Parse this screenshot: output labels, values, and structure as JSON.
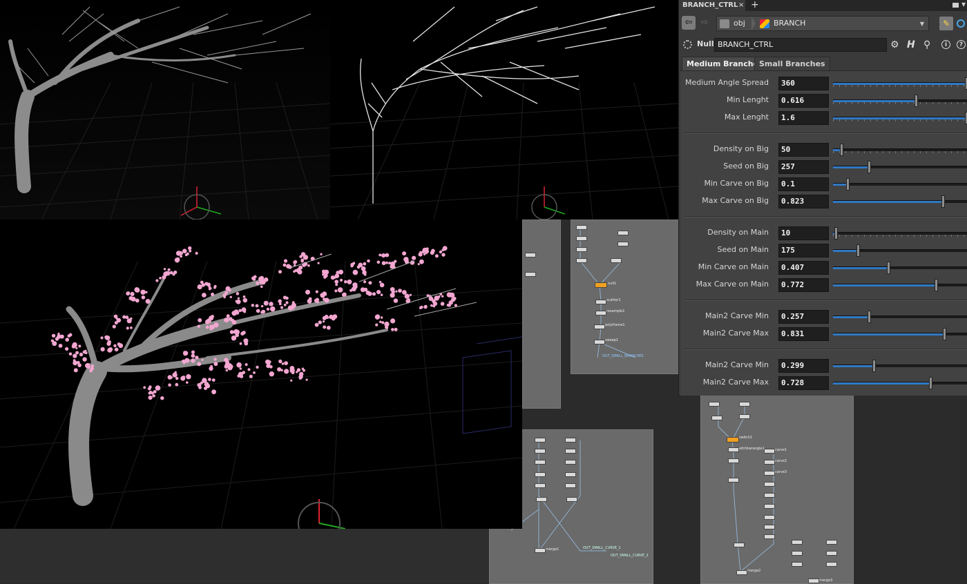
{
  "tab": {
    "title": "BRANCH_CTRL",
    "close": "×",
    "add": "+"
  },
  "path": {
    "back": "⇦",
    "forward": "⇨",
    "root": "obj",
    "node": "BRANCH",
    "dropdown": "▼"
  },
  "operator": {
    "type": "Null",
    "name": "BRANCH_CTRL",
    "help_letter": "H",
    "info_letter": "i",
    "question": "?"
  },
  "folders": [
    {
      "label": "Medium Branches",
      "active": true
    },
    {
      "label": "Small Branches",
      "active": false
    }
  ],
  "params": [
    {
      "label": "Medium Angle Spread",
      "value": "360",
      "slider": 1.0,
      "ticks": true
    },
    {
      "label": "Min Lenght",
      "value": "0.616",
      "slider": 0.62,
      "ticks": true
    },
    {
      "label": "Max Lenght",
      "value": "1.6",
      "slider": 1.0,
      "ticks": true
    },
    {
      "label": "Density on Big",
      "value": "50",
      "slider": 0.05,
      "ticks": true
    },
    {
      "label": "Seed on Big",
      "value": "257",
      "slider": 0.26,
      "ticks": false
    },
    {
      "label": "Min Carve on Big",
      "value": "0.1",
      "slider": 0.1,
      "ticks": false
    },
    {
      "label": "Max Carve on Big",
      "value": "0.823",
      "slider": 0.82,
      "ticks": false
    },
    {
      "label": "Density on Main",
      "value": "10",
      "slider": 0.01,
      "ticks": true
    },
    {
      "label": "Seed on Main",
      "value": "175",
      "slider": 0.18,
      "ticks": false
    },
    {
      "label": "Min Carve on Main",
      "value": "0.407",
      "slider": 0.41,
      "ticks": false
    },
    {
      "label": "Max Carve on Main",
      "value": "0.772",
      "slider": 0.77,
      "ticks": false
    },
    {
      "label": "Main2 Carve Min",
      "value": "0.257",
      "slider": 0.26,
      "ticks": false
    },
    {
      "label": "Main2 Carve Max",
      "value": "0.831",
      "slider": 0.83,
      "ticks": false
    },
    {
      "label": "Main2 Carve Min",
      "value": "0.299",
      "slider": 0.3,
      "ticks": false
    },
    {
      "label": "Main2 Carve Max",
      "value": "0.728",
      "slider": 0.73,
      "ticks": false
    }
  ],
  "network": {
    "labels": [
      "OUT_SMALL_BRANCHES",
      "OUT_SMALL_CURVE_1",
      "OUT_SMALL_CURVE_2",
      "merge1",
      "merge2",
      "merge3",
      "null1",
      "scatter1",
      "resample1",
      "polyframe1",
      "sweep1",
      "attribwrangle1",
      "switch1",
      "carve1",
      "carve2",
      "carve3"
    ]
  },
  "colors": {
    "accent": "#2f79c4",
    "highlight": "#f0a020",
    "blossom": "#f2a6d0"
  }
}
